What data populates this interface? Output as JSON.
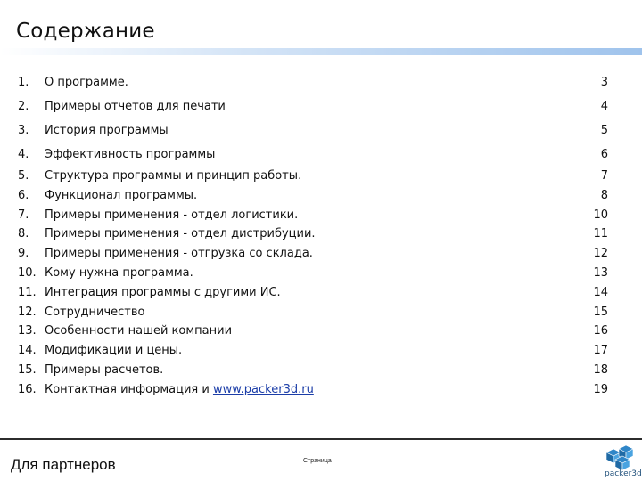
{
  "title": "Содержание",
  "toc": [
    {
      "num": "1.",
      "text": "О программе.",
      "page": "3"
    },
    {
      "num": "2.",
      "text": "Примеры отчетов для печати",
      "page": "4"
    },
    {
      "num": "3.",
      "text": "История программы",
      "page": "5"
    },
    {
      "num": "4.",
      "text": "Эффективность программы",
      "page": "6"
    },
    {
      "num": "5.",
      "text": "Структура программы и принцип работы.",
      "page": "7"
    },
    {
      "num": "6.",
      "text": "Функционал программы.",
      "page": "8"
    },
    {
      "num": "7.",
      "text": "Примеры применения - отдел логистики.",
      "page": "10"
    },
    {
      "num": "8.",
      "text": "Примеры применения - отдел дистрибуции.",
      "page": "11"
    },
    {
      "num": "9.",
      "text": "Примеры применения - отгрузка со склада.",
      "page": "12"
    },
    {
      "num": "10.",
      "text": "Кому нужна программа.",
      "page": "13"
    },
    {
      "num": "11.",
      "text": "Интеграция программы с другими ИС.",
      "page": "14"
    },
    {
      "num": "12.",
      "text": "Сотрудничество",
      "page": "15"
    },
    {
      "num": "13.",
      "text": "Особенности нашей компании",
      "page": "16"
    },
    {
      "num": "14.",
      "text": "Модификации и цены.",
      "page": "17"
    },
    {
      "num": "15.",
      "text": "Примеры расчетов.",
      "page": "18"
    },
    {
      "num": "16.",
      "text": "Контактная информация и ",
      "link": "www.packer3d.ru",
      "page": "19"
    }
  ],
  "footer": {
    "label": "Для партнеров",
    "page_label": "Страница",
    "logo_text": "packer3d"
  },
  "colors": {
    "accent_blue": "#9fc3ec",
    "link": "#1b3da8",
    "logo": "#2f86c8"
  },
  "icons": {
    "logo": "packer3d-cubes-logo"
  }
}
